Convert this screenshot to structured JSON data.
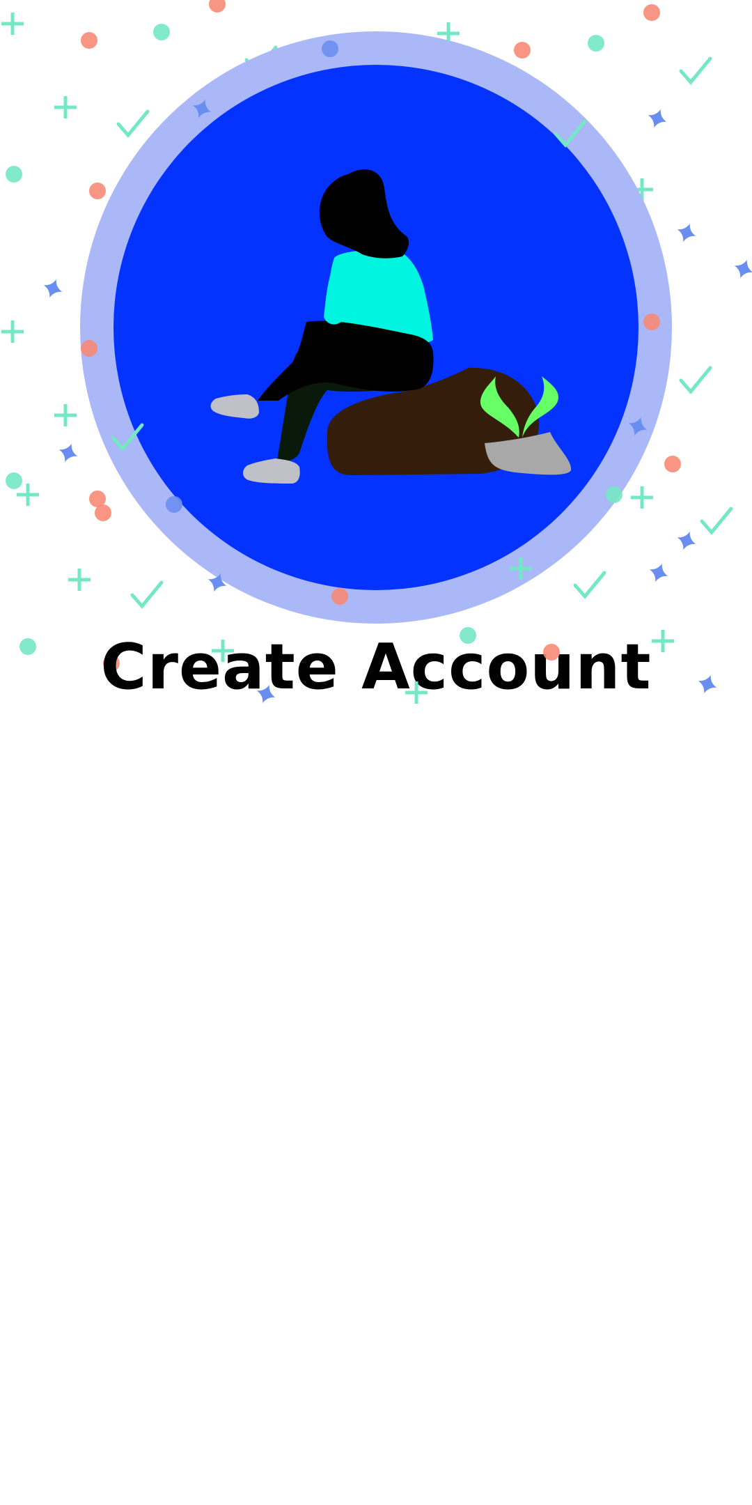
{
  "screen": {
    "title": "Create Account"
  },
  "illustration": {
    "icon": "woman-sitting-on-rock-illustration",
    "colors": {
      "background": "#ffffff",
      "ring": "#aab8f8",
      "disc": "#0433ff",
      "hair": "#000000",
      "top": "#00f5e0",
      "pants": "#0a1a0a",
      "shoes": "#c0c0c8",
      "rock": "#351d0c",
      "stone": "#a8a8a8",
      "sprout": "#66ff66",
      "confetti_mint": "#74e8c4",
      "confetti_coral": "#f88a76",
      "confetti_blue": "#6a8ef0"
    }
  }
}
